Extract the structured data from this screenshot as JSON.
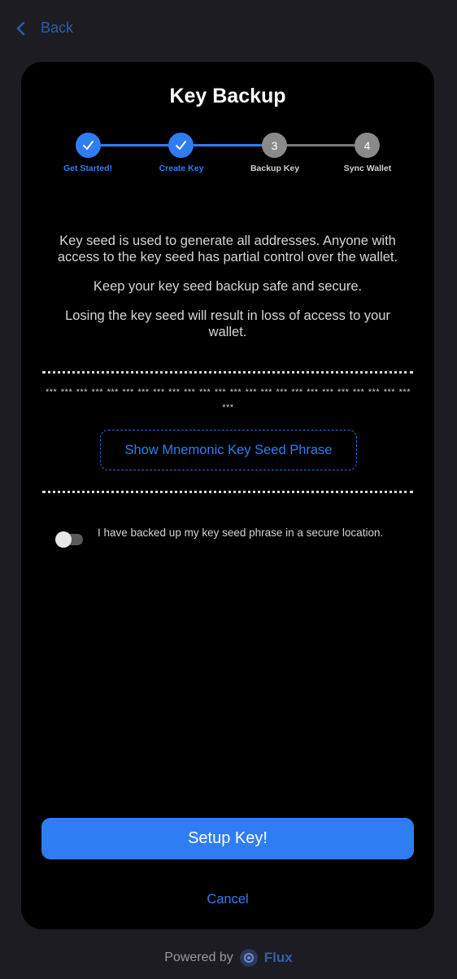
{
  "nav": {
    "back_label": "Back"
  },
  "page": {
    "title": "Key Backup"
  },
  "stepper": {
    "steps": [
      {
        "label": "Get Started!",
        "number": "1",
        "state": "done"
      },
      {
        "label": "Create Key",
        "number": "2",
        "state": "done"
      },
      {
        "label": "Backup Key",
        "number": "3",
        "state": "pending"
      },
      {
        "label": "Sync Wallet",
        "number": "4",
        "state": "pending"
      }
    ]
  },
  "description": {
    "p1": "Key seed is used to generate all addresses. Anyone with access to the key seed has partial control over the wallet.",
    "p2": "Keep your key seed backup safe and secure.",
    "p3": "Losing the key seed will result in loss of access to your wallet."
  },
  "seed": {
    "masked": "*** *** *** *** *** *** *** *** *** *** *** *** *** *** *** *** *** *** *** *** *** *** *** *** ***",
    "show_button_label": "Show Mnemonic Key Seed Phrase"
  },
  "confirm": {
    "label": "I have backed up my key seed phrase in a secure location.",
    "checked": false
  },
  "actions": {
    "primary_label": "Setup Key!",
    "cancel_label": "Cancel"
  },
  "footer": {
    "powered_by": "Powered by",
    "brand": "Flux"
  },
  "colors": {
    "accent": "#2f7df2",
    "background": "#1c1c22",
    "card": "#000000",
    "step_pending": "#8a8a8a",
    "step_line_pending": "#777777"
  }
}
